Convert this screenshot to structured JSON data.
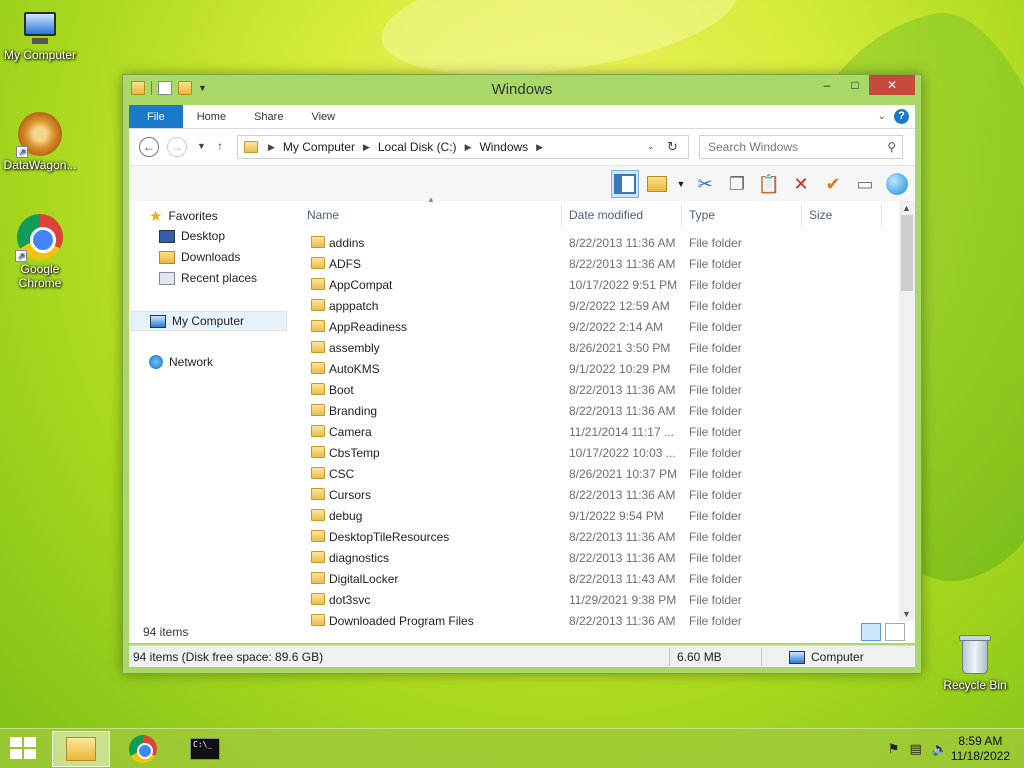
{
  "desktop": {
    "icons": [
      {
        "label": "My Computer"
      },
      {
        "label": "DataWagon..."
      },
      {
        "label": "Google Chrome"
      },
      {
        "label": "Recycle Bin"
      }
    ]
  },
  "window": {
    "title": "Windows",
    "caption": {
      "minimize": "–",
      "maximize": "□",
      "close": "✕"
    }
  },
  "ribbon": {
    "tabs": [
      "File",
      "Home",
      "Share",
      "View"
    ],
    "collapse_glyph": "⌄",
    "help_glyph": "?"
  },
  "address": {
    "crumbs": [
      "My Computer",
      "Local Disk (C:)",
      "Windows"
    ],
    "search_placeholder": "Search Windows"
  },
  "nav": {
    "favorites": "Favorites",
    "desktop": "Desktop",
    "downloads": "Downloads",
    "recent": "Recent places",
    "computer": "My Computer",
    "network": "Network"
  },
  "columns": {
    "name": "Name",
    "date": "Date modified",
    "type": "Type",
    "size": "Size"
  },
  "files": [
    {
      "name": "addins",
      "date": "8/22/2013 11:36 AM",
      "type": "File folder"
    },
    {
      "name": "ADFS",
      "date": "8/22/2013 11:36 AM",
      "type": "File folder"
    },
    {
      "name": "AppCompat",
      "date": "10/17/2022 9:51 PM",
      "type": "File folder"
    },
    {
      "name": "apppatch",
      "date": "9/2/2022 12:59 AM",
      "type": "File folder"
    },
    {
      "name": "AppReadiness",
      "date": "9/2/2022 2:14 AM",
      "type": "File folder"
    },
    {
      "name": "assembly",
      "date": "8/26/2021 3:50 PM",
      "type": "File folder"
    },
    {
      "name": "AutoKMS",
      "date": "9/1/2022 10:29 PM",
      "type": "File folder"
    },
    {
      "name": "Boot",
      "date": "8/22/2013 11:36 AM",
      "type": "File folder"
    },
    {
      "name": "Branding",
      "date": "8/22/2013 11:36 AM",
      "type": "File folder"
    },
    {
      "name": "Camera",
      "date": "11/21/2014 11:17 ...",
      "type": "File folder"
    },
    {
      "name": "CbsTemp",
      "date": "10/17/2022 10:03 ...",
      "type": "File folder"
    },
    {
      "name": "CSC",
      "date": "8/26/2021 10:37 PM",
      "type": "File folder"
    },
    {
      "name": "Cursors",
      "date": "8/22/2013 11:36 AM",
      "type": "File folder"
    },
    {
      "name": "debug",
      "date": "9/1/2022 9:54 PM",
      "type": "File folder"
    },
    {
      "name": "DesktopTileResources",
      "date": "8/22/2013 11:36 AM",
      "type": "File folder"
    },
    {
      "name": "diagnostics",
      "date": "8/22/2013 11:36 AM",
      "type": "File folder"
    },
    {
      "name": "DigitalLocker",
      "date": "8/22/2013 11:43 AM",
      "type": "File folder"
    },
    {
      "name": "dot3svc",
      "date": "11/29/2021 9:38 PM",
      "type": "File folder"
    },
    {
      "name": "Downloaded Program Files",
      "date": "8/22/2013 11:36 AM",
      "type": "File folder"
    }
  ],
  "item_count": "94 items",
  "status": {
    "left": "94 items (Disk free space: 89.6 GB)",
    "size": "6.60 MB",
    "location": "Computer"
  },
  "taskbar": {
    "cmd_prompt_glyph": "C:\\_",
    "time": "8:59 AM",
    "date": "11/18/2022"
  }
}
